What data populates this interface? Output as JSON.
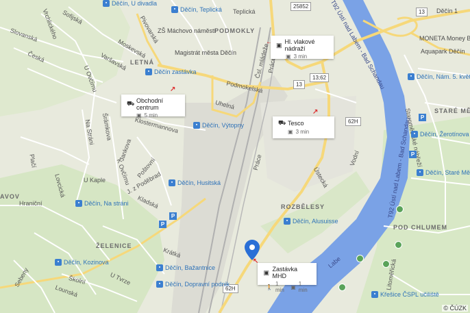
{
  "map": {
    "copyright": "© ČÚZK",
    "districts": [
      "PODMOKLY",
      "LETNÁ",
      "ROZBĚLESY",
      "ŽELENICE",
      "STARÉ MĚSTO",
      "POD CHLUMEM",
      "AVOV"
    ],
    "streets": [
      "Sofijská",
      "Slovanská",
      "Česká",
      "Vrchlického",
      "Moskevská",
      "Varšavská",
      "Zámecká",
      "Kosmická",
      "U Ovčírnu",
      "Ruská",
      "Klostermannova",
      "Na Stráni",
      "Šrámkova",
      "Jankova",
      "K Ovčírnu",
      "Poštovní",
      "U Kaple",
      "J. z Poděbrad",
      "Plačí",
      "Jižní",
      "Lovcická",
      "Hraniční",
      "Kladská",
      "Krátká",
      "Lounská",
      "Školní",
      "U Tvrze",
      "Sebeny",
      "Ústecká",
      "Vodní",
      "Práce",
      "Uhelná",
      "Podmokelská",
      "Čsl. mládeže",
      "Teplická",
      "Staroměstské nábřeží",
      "Litoměřická",
      "Labe",
      "Riegrova",
      "Resslova",
      "Pivovarská",
      "Žlutá",
      "Práce"
    ],
    "river_labels": [
      "T92 Ústí nad Labem - Bad Schandau",
      "T92 Ústí nad Labem - Bad Schandau",
      "Labe"
    ],
    "road_shields": [
      "25852",
      "13",
      "13;62",
      "13",
      "62H",
      "62H"
    ],
    "places": [
      "ZŠ Máchovo náměstí",
      "Magistrát města Děčín",
      "MONETA Money Bank",
      "Aquapark Děčín",
      "Děčín 1"
    ],
    "stops": [
      "Děčín, U divadla",
      "Děčín, Teplická",
      "Děčín zastávka",
      "Děčín, Nám. 5. května",
      "Děčín, Žerotínova",
      "Děčín, Staré Město",
      "Děčín, Výtopny",
      "Děčín, Husitská",
      "Děčín, Na stráni",
      "Děčín, Alusuisse",
      "Děčín, Kozinova",
      "Děčín, Bažantnice",
      "Děčín, Dopravní podnik",
      "Děčín, Sukova",
      "Křešice ČSPL učiliště",
      "Děčín, Teplická"
    ],
    "cards": [
      {
        "title": "Hl. vlakové nádraží",
        "mode": "🚌",
        "time": "3 min"
      },
      {
        "title": "Obchodní centrum",
        "mode": "🚌",
        "time": "5 min"
      },
      {
        "title": "Tesco",
        "mode": "🚌",
        "time": "3 min"
      },
      {
        "title": "Zastávka MHD",
        "walk": "1 min",
        "bus": "1 min"
      }
    ]
  },
  "colors": {
    "water": "#7aa2e6",
    "road_major": "#f6d87a",
    "road_minor": "#ffffff",
    "rail": "#b5b5b5",
    "pin": "#2a6fd6",
    "green": "#cfe5b8"
  }
}
